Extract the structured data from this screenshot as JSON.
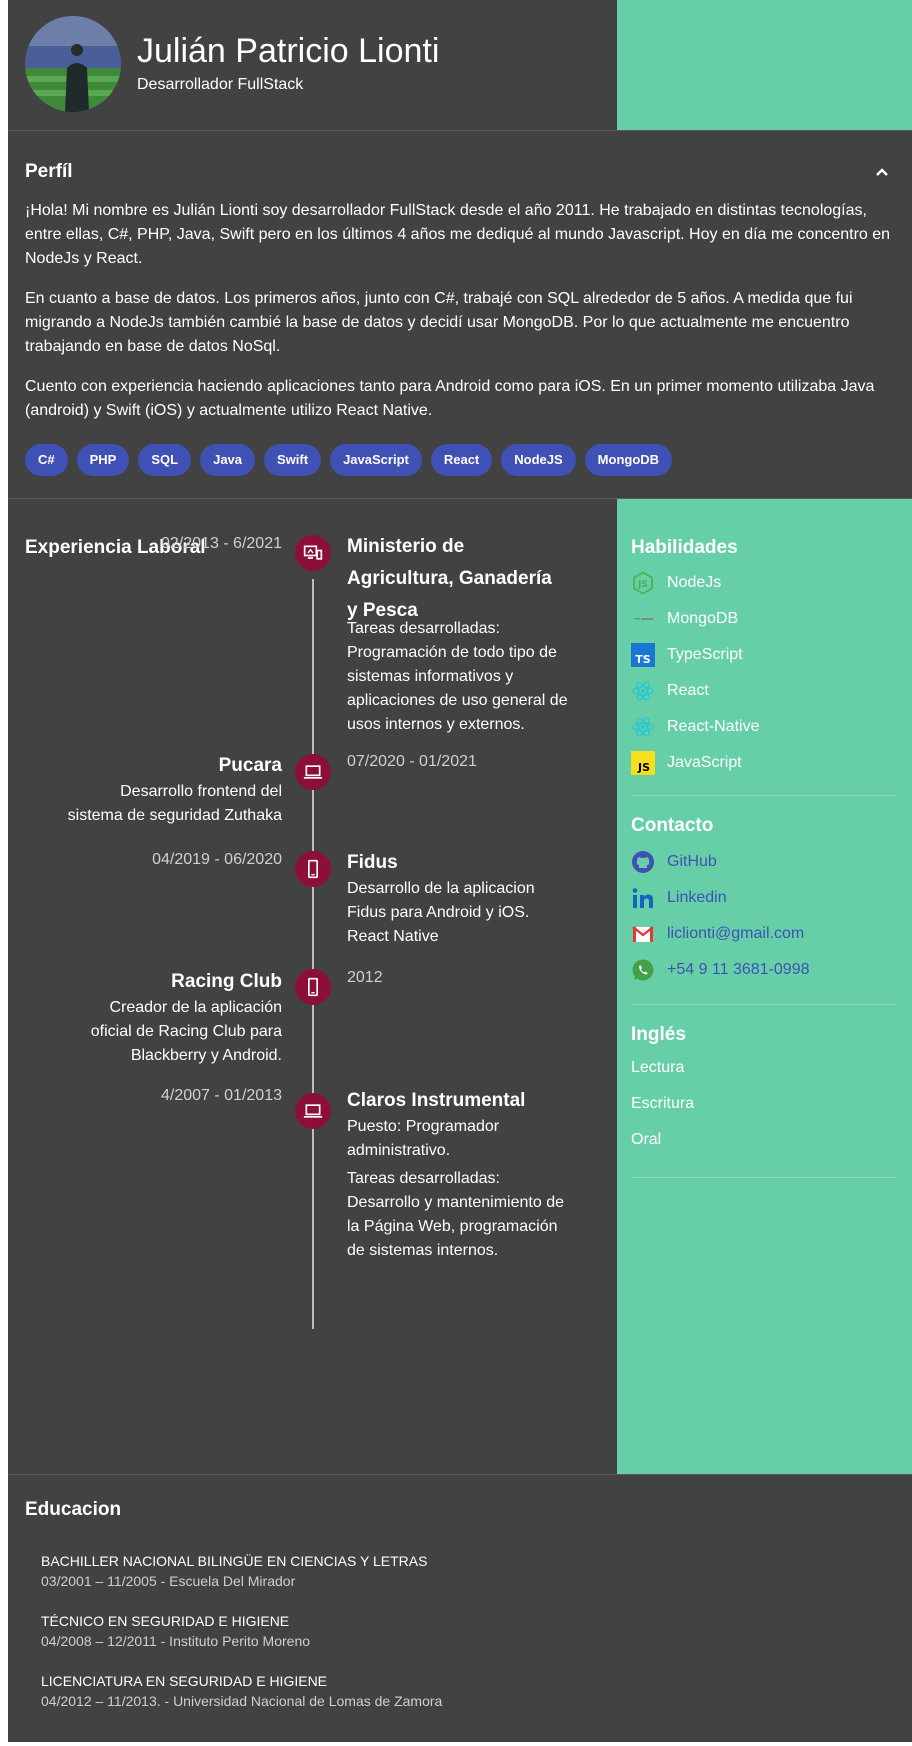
{
  "header": {
    "name": "Julián Patricio Lionti",
    "role": "Desarrollador FullStack",
    "accent_color": "#66cfa8"
  },
  "perfil": {
    "title": "Perfíl",
    "paragraphs": [
      "¡Hola! Mi nombre es Julián Lionti soy desarrollador FullStack desde el año 2011. He trabajado en distintas tecnologías, entre ellas, C#, PHP, Java, Swift pero en los últimos 4 años me dediqué al mundo Javascript. Hoy en día me concentro en NodeJs y React.",
      "En cuanto a base de datos. Los primeros años, junto con C#, trabajé con SQL alrededor de 5 años. A medida que fui migrando a NodeJs también cambié la base de datos y decidí usar MongoDB. Por lo que actualmente me encuentro trabajando en base de datos NoSql.",
      "Cuento con experiencia haciendo aplicaciones tanto para Android como para iOS. En un primer momento utilizaba Java (android) y Swift (iOS) y actualmente utilizo React Native."
    ],
    "chips": [
      "C#",
      "PHP",
      "SQL",
      "Java",
      "Swift",
      "JavaScript",
      "React",
      "NodeJS",
      "MongoDB"
    ],
    "chip_color": "#3f51b5"
  },
  "experiencia": {
    "title": "Experiencia Laboral",
    "items": [
      {
        "date": "02/2013 - 6/2021",
        "title": "Ministerio de Agricultura, Ganadería y Pesca",
        "desc": [
          "Tareas desarrolladas: Programación de todo tipo de sistemas informativos y aplicaciones de uso general de usos internos y externos."
        ],
        "icon": "monitor-phone-icon"
      },
      {
        "date": "07/2020 - 01/2021",
        "title": "Pucara",
        "desc": [
          "Desarrollo frontend del sistema de seguridad Zuthaka"
        ],
        "icon": "laptop-icon"
      },
      {
        "date": "04/2019 - 06/2020",
        "title": "Fidus",
        "desc": [
          "Desarrollo de la aplicacion Fidus para Android y iOS. React Native"
        ],
        "icon": "smartphone-icon"
      },
      {
        "date": "2012",
        "title": "Racing Club",
        "desc": [
          "Creador de la aplicación oficial de Racing Club para Blackberry y Android."
        ],
        "icon": "smartphone-icon"
      },
      {
        "date": "4/2007 - 01/2013",
        "title": "Claros Instrumental",
        "desc": [
          "Puesto: Programador administrativo.",
          "Tareas desarrolladas: Desarrollo y mantenimiento de la Página Web, programación de sistemas internos."
        ],
        "icon": "laptop-icon"
      }
    ],
    "dot_color": "#8b0f38"
  },
  "habilidades": {
    "title": "Habilidades",
    "items": [
      {
        "label": "NodeJs",
        "icon": "nodejs-icon"
      },
      {
        "label": "MongoDB",
        "icon": "mongodb-icon"
      },
      {
        "label": "TypeScript",
        "icon": "typescript-icon"
      },
      {
        "label": "React",
        "icon": "react-icon"
      },
      {
        "label": "React-Native",
        "icon": "react-icon"
      },
      {
        "label": "JavaScript",
        "icon": "javascript-icon"
      }
    ]
  },
  "contacto": {
    "title": "Contacto",
    "items": [
      {
        "label": "GitHub",
        "icon": "github-icon"
      },
      {
        "label": "Linkedin",
        "icon": "linkedin-icon"
      },
      {
        "label": "liclionti@gmail.com",
        "icon": "gmail-icon"
      },
      {
        "label": "+54 9 11 3681-0998",
        "icon": "whatsapp-icon"
      }
    ]
  },
  "ingles": {
    "title": "Inglés",
    "items": [
      "Lectura",
      "Escritura",
      "Oral"
    ]
  },
  "educacion": {
    "title": "Educacion",
    "items": [
      {
        "title": "BACHILLER NACIONAL BILINGÜE EN CIENCIAS Y LETRAS",
        "sub": "03/2001 – 11/2005 - Escuela Del Mirador"
      },
      {
        "title": "TÉCNICO EN SEGURIDAD E HIGIENE",
        "sub": "04/2008 – 12/2011 - Instituto Perito Moreno"
      },
      {
        "title": "LICENCIATURA EN SEGURIDAD E HIGIENE",
        "sub": "04/2012 – 11/2013. - Universidad Nacional de Lomas de Zamora"
      }
    ]
  }
}
